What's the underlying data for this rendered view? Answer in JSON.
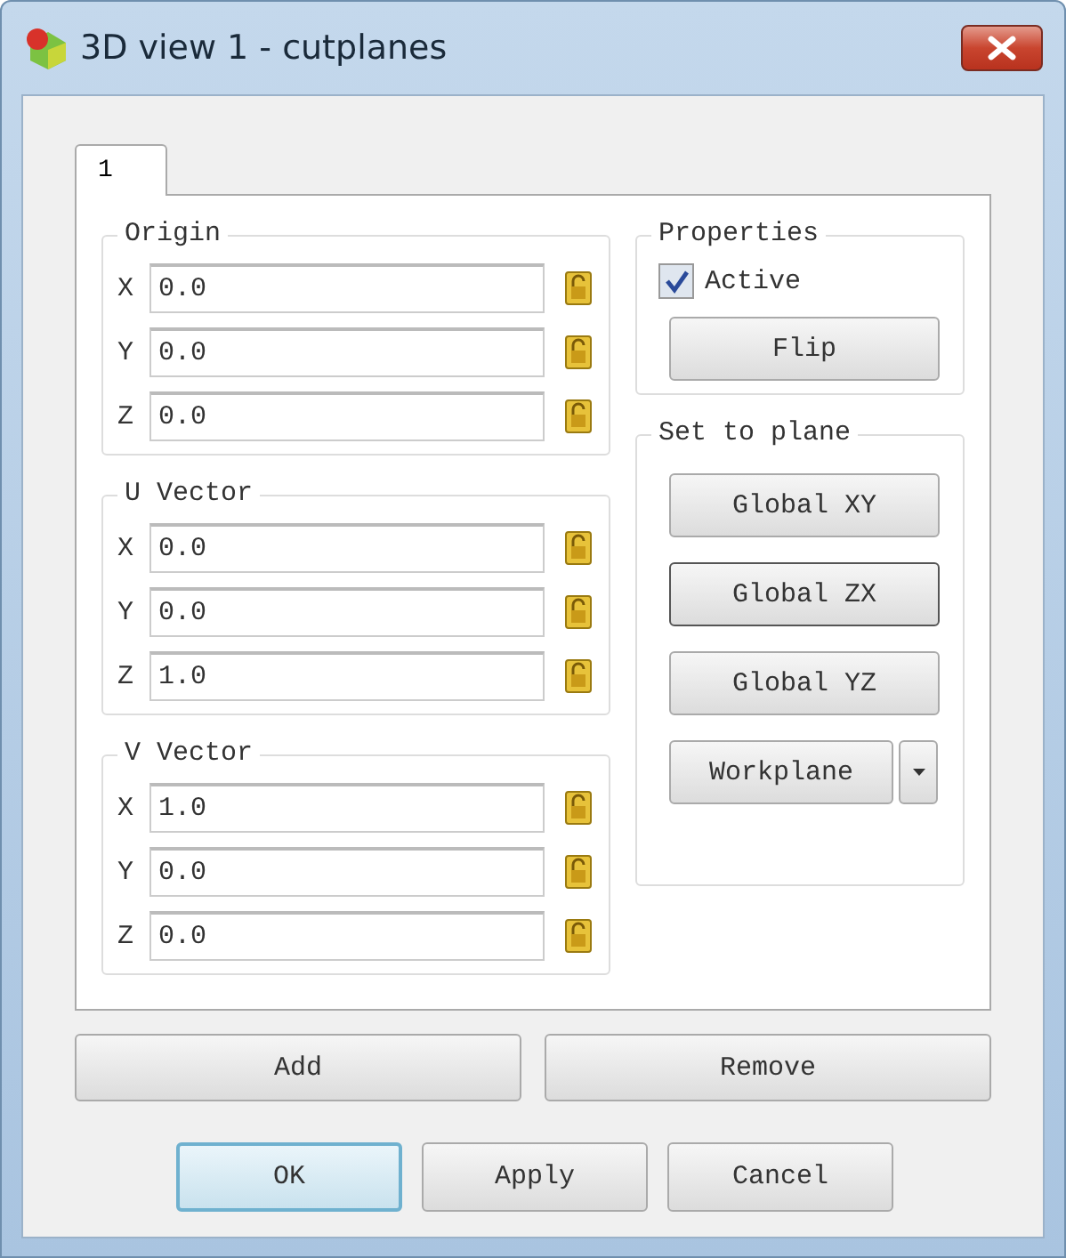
{
  "window": {
    "title": "3D view 1 - cutplanes"
  },
  "tabs": [
    {
      "label": "1",
      "selected": true
    }
  ],
  "vector_groups": [
    {
      "title": "Origin",
      "fields": [
        {
          "axis": "X",
          "value": "0.0"
        },
        {
          "axis": "Y",
          "value": "0.0"
        },
        {
          "axis": "Z",
          "value": "0.0"
        }
      ]
    },
    {
      "title": "U Vector",
      "fields": [
        {
          "axis": "X",
          "value": "0.0"
        },
        {
          "axis": "Y",
          "value": "0.0"
        },
        {
          "axis": "Z",
          "value": "1.0"
        }
      ]
    },
    {
      "title": "V Vector",
      "fields": [
        {
          "axis": "X",
          "value": "1.0"
        },
        {
          "axis": "Y",
          "value": "0.0"
        },
        {
          "axis": "Z",
          "value": "0.0"
        }
      ]
    }
  ],
  "properties": {
    "title": "Properties",
    "active": {
      "label": "Active",
      "checked": true
    },
    "flip": "Flip"
  },
  "set_to_plane": {
    "title": "Set to plane",
    "buttons": [
      {
        "label": "Global XY",
        "focused": false
      },
      {
        "label": "Global ZX",
        "focused": true
      },
      {
        "label": "Global YZ",
        "focused": false
      }
    ],
    "workplane": "Workplane"
  },
  "list_buttons": [
    "Add",
    "Remove"
  ],
  "dialog_buttons": [
    {
      "label": "OK",
      "default": true
    },
    {
      "label": "Apply",
      "default": false
    },
    {
      "label": "Cancel",
      "default": false
    }
  ]
}
